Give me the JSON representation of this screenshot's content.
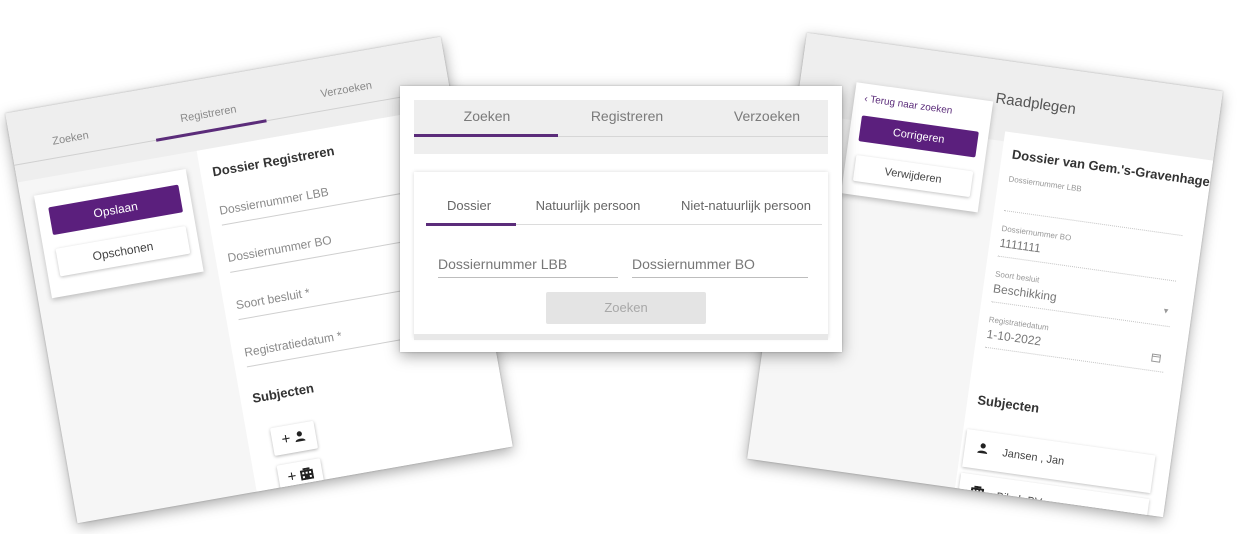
{
  "left_screen": {
    "tabs": [
      "Zoeken",
      "Registreren",
      "Verzoeken"
    ],
    "active_tab_index": 1,
    "save_button": "Opslaan",
    "clear_button": "Opschonen",
    "form_title": "Dossier Registreren",
    "fields": [
      "Dossiernummer LBB",
      "Dossiernummer BO",
      "Soort besluit *",
      "Registratiedatum *"
    ],
    "subjects_title": "Subjecten",
    "add_person_icon": "person-icon",
    "add_building_icon": "building-icon",
    "plus_symbol": "+",
    "accent_color": "#5b1f7d"
  },
  "center_screen": {
    "tabs": [
      "Zoeken",
      "Registreren",
      "Verzoeken"
    ],
    "active_tab_index": 0,
    "subtabs": [
      "Dossier",
      "Natuurlijk persoon",
      "Niet-natuurlijk persoon"
    ],
    "active_subtab_index": 0,
    "fields": [
      "Dossiernummer LBB",
      "Dossiernummer BO"
    ],
    "search_button": "Zoeken"
  },
  "right_screen": {
    "title": "Raadplegen",
    "back_link": "Terug naar zoeken",
    "correct_button": "Corrigeren",
    "delete_button": "Verwijderen",
    "dossier_title": "Dossier van Gem.'s-Gravenhage",
    "fields": [
      {
        "label": "Dossiernummer LBB",
        "value": ""
      },
      {
        "label": "Dossiernummer BO",
        "value": "1111111"
      },
      {
        "label": "Soort besluit",
        "value": "Beschikking"
      },
      {
        "label": "Registratiedatum",
        "value": "1-10-2022"
      }
    ],
    "subjects_title": "Subjecten",
    "subjects": [
      {
        "icon": "person-icon",
        "name": "Jansen , Jan"
      },
      {
        "icon": "building-icon",
        "name": "Bibob BV"
      }
    ]
  }
}
